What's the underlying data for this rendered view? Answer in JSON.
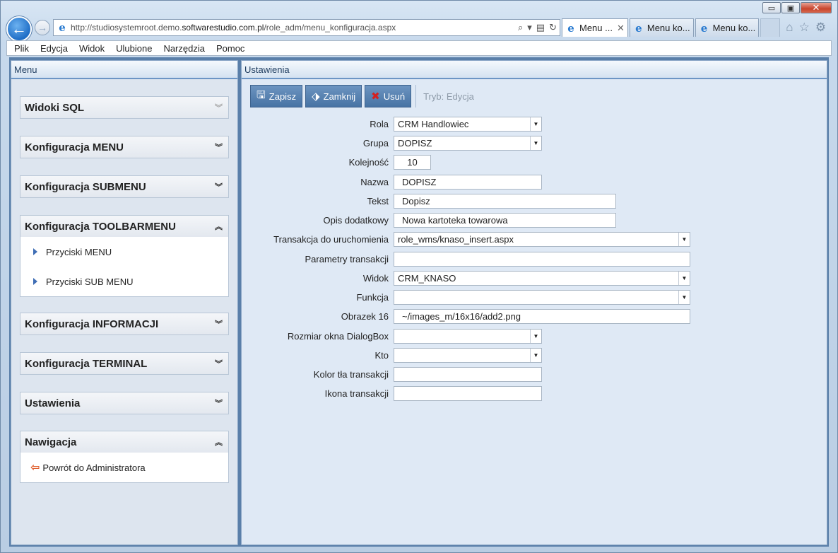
{
  "window": {
    "controls": {
      "minimize": "▭",
      "restore": "▣",
      "close": "✕"
    }
  },
  "nav": {
    "url_prefix": "http://studiosystemroot.demo.",
    "url_domain": "softwarestudio.com.pl",
    "url_path": "/role_adm/menu_konfiguracja.aspx",
    "tabs": [
      {
        "label": "Menu ...",
        "active": true,
        "close": "✕"
      },
      {
        "label": "Menu ko...",
        "active": false
      },
      {
        "label": "Menu ko...",
        "active": false
      }
    ]
  },
  "menubar": [
    "Plik",
    "Edycja",
    "Widok",
    "Ulubione",
    "Narzędzia",
    "Pomoc"
  ],
  "left_panel": {
    "title": "Menu",
    "sections": [
      {
        "label": "Widoki SQL",
        "expanded": false,
        "items": []
      },
      {
        "label": "Konfiguracja MENU",
        "expanded": false,
        "items": []
      },
      {
        "label": "Konfiguracja SUBMENU",
        "expanded": false,
        "items": []
      },
      {
        "label": "Konfiguracja TOOLBARMENU",
        "expanded": true,
        "items": [
          "Przyciski MENU",
          "Przyciski SUB MENU"
        ]
      },
      {
        "label": "Konfiguracja INFORMACJI",
        "expanded": false,
        "items": []
      },
      {
        "label": "Konfiguracja TERMINAL",
        "expanded": false,
        "items": []
      },
      {
        "label": "Ustawienia",
        "expanded": false,
        "items": []
      },
      {
        "label": "Nawigacja",
        "expanded": true,
        "items": [
          "Powrót do Administratora"
        ]
      }
    ]
  },
  "right_panel": {
    "title": "Ustawienia",
    "toolbar": {
      "save_label": "Zapisz",
      "close_label": "Zamknij",
      "delete_label": "Usuń",
      "mode_label": "Tryb: Edycja"
    },
    "form": [
      {
        "label": "Rola",
        "value": "CRM Handlowiec",
        "type": "select"
      },
      {
        "label": "Grupa",
        "value": "DOPISZ",
        "type": "select"
      },
      {
        "label": "Kolejność",
        "value": "10",
        "type": "number"
      },
      {
        "label": "Nazwa",
        "value": "DOPISZ",
        "type": "text"
      },
      {
        "label": "Tekst",
        "value": "Dopisz",
        "type": "text"
      },
      {
        "label": "Opis dodatkowy",
        "value": "Nowa kartoteka towarowa",
        "type": "text"
      },
      {
        "label": "Transakcja do uruchomienia",
        "value": "role_wms/knaso_insert.aspx",
        "type": "select"
      },
      {
        "label": "Parametry transakcji",
        "value": "",
        "type": "text"
      },
      {
        "label": "Widok",
        "value": "CRM_KNASO",
        "type": "select"
      },
      {
        "label": "Funkcja",
        "value": "",
        "type": "select"
      },
      {
        "label": "Obrazek 16",
        "value": "~/images_m/16x16/add2.png",
        "type": "text"
      },
      {
        "label": "Rozmiar okna DialogBox",
        "value": "",
        "type": "select"
      },
      {
        "label": "Kto",
        "value": "",
        "type": "select"
      },
      {
        "label": "Kolor tła transakcji",
        "value": "",
        "type": "text"
      },
      {
        "label": "Ikona transakcji",
        "value": "",
        "type": "text"
      }
    ]
  },
  "colors": {
    "accent": "#4773a4",
    "panel_bg": "#dfe9f5",
    "delete_icon": "#d42020"
  }
}
